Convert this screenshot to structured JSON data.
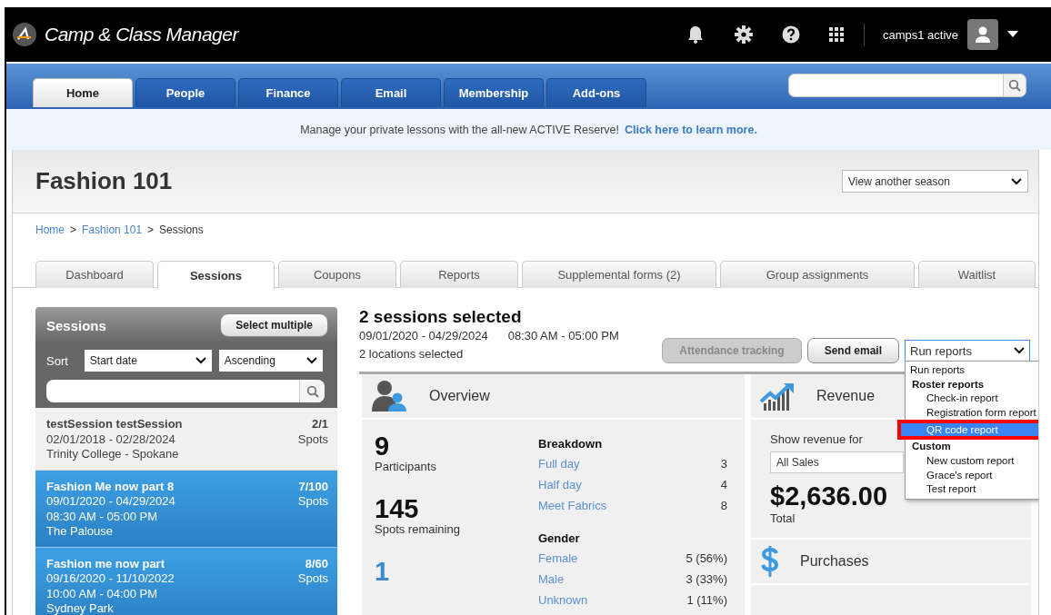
{
  "header": {
    "app_name": "Camp & Class Manager",
    "user_name": "camps1 active"
  },
  "nav": {
    "tabs": [
      {
        "label": "Home",
        "selected": true
      },
      {
        "label": "People",
        "selected": false
      },
      {
        "label": "Finance",
        "selected": false
      },
      {
        "label": "Email",
        "selected": false
      },
      {
        "label": "Membership",
        "selected": false
      },
      {
        "label": "Add-ons",
        "selected": false
      }
    ]
  },
  "banner": {
    "text": "Manage your private lessons with the all-new ACTIVE Reserve!",
    "link": "Click here to learn more."
  },
  "page": {
    "title": "Fashion 101",
    "season_select": "View another season"
  },
  "breadcrumb": [
    {
      "kind": "link",
      "label": "Home"
    },
    {
      "kind": "separator",
      "label": ">"
    },
    {
      "kind": "link",
      "label": "Fashion 101"
    },
    {
      "kind": "separator",
      "label": ">"
    },
    {
      "kind": "current",
      "label": "Sessions"
    }
  ],
  "subtabs": [
    {
      "label": "Dashboard",
      "selected": false
    },
    {
      "label": "Sessions",
      "selected": true
    },
    {
      "label": "Coupons",
      "selected": false
    },
    {
      "label": "Reports",
      "selected": false
    },
    {
      "label": "Supplemental forms (2)",
      "selected": false
    },
    {
      "label": "Group assignments",
      "selected": false
    },
    {
      "label": "Waitlist",
      "selected": false
    }
  ],
  "sessions_panel": {
    "title": "Sessions",
    "select_button": "Select multiple",
    "sort_label": "Sort",
    "sort_by": "Start date",
    "sort_order": "Ascending",
    "items": [
      {
        "name": "testSession testSession",
        "lines": [
          "02/01/2018 - 02/28/2024",
          "Trinity College - Spokane"
        ],
        "count": "2/1",
        "unit": "Spots",
        "selected": false
      },
      {
        "name": "Fashion Me now part 8",
        "lines": [
          "09/01/2020 - 04/29/2024",
          "08:30 AM - 05:00 PM",
          "The Palouse"
        ],
        "count": "7/100",
        "unit": "Spots",
        "selected": true
      },
      {
        "name": "Fashion me now part",
        "lines": [
          "09/16/2020 - 11/10/2022",
          "10:00 AM - 04:00 PM",
          "Sydney Park"
        ],
        "count": "8/60",
        "unit": "Spots",
        "selected": true
      }
    ]
  },
  "selection": {
    "title": "2 sessions selected",
    "dates": "09/01/2020 - 04/29/2024",
    "times": "08:30 AM - 05:00 PM",
    "locations": "2 locations selected",
    "buttons": [
      {
        "label": "Attendance tracking",
        "disabled": true
      },
      {
        "label": "Send email",
        "disabled": false
      }
    ],
    "report_select": "Run reports",
    "report_menu": [
      {
        "kind": "option",
        "label": "Run reports",
        "selected": false
      },
      {
        "kind": "group",
        "label": "Roster reports",
        "children": [
          {
            "kind": "option",
            "label": "Check-in report",
            "selected": false
          },
          {
            "kind": "option",
            "label": "Registration form report",
            "selected": false
          },
          {
            "kind": "option",
            "label": "QR code report",
            "selected": true
          }
        ]
      },
      {
        "kind": "group",
        "label": "Custom",
        "children": [
          {
            "kind": "option",
            "label": "New custom report",
            "selected": false
          },
          {
            "kind": "option",
            "label": "Grace's report",
            "selected": false
          },
          {
            "kind": "option",
            "label": "Test report",
            "selected": false
          }
        ]
      }
    ]
  },
  "overview": {
    "title": "Overview",
    "stats": [
      {
        "kind": "plain",
        "value": "9",
        "label": "Participants"
      },
      {
        "kind": "plain",
        "value": "145",
        "label": "Spots remaining"
      },
      {
        "kind": "link",
        "value": "1"
      }
    ],
    "groups": [
      {
        "title": "Breakdown",
        "rows": [
          {
            "label": "Full day",
            "value": "3"
          },
          {
            "label": "Half day",
            "value": "4"
          },
          {
            "label": "Meet Fabrics",
            "value": "8"
          }
        ]
      },
      {
        "title": "Gender",
        "rows": [
          {
            "label": "Female",
            "value": "5 (56%)"
          },
          {
            "label": "Male",
            "value": "3 (33%)"
          },
          {
            "label": "Unknown",
            "value": "1 (11%)"
          }
        ]
      }
    ]
  },
  "revenue": {
    "title": "Revenue",
    "filter_label": "Show revenue for",
    "filter_value": "All Sales",
    "amount": "$2,636.00",
    "amount_label": "Total"
  },
  "purchases": {
    "title": "Purchases"
  }
}
